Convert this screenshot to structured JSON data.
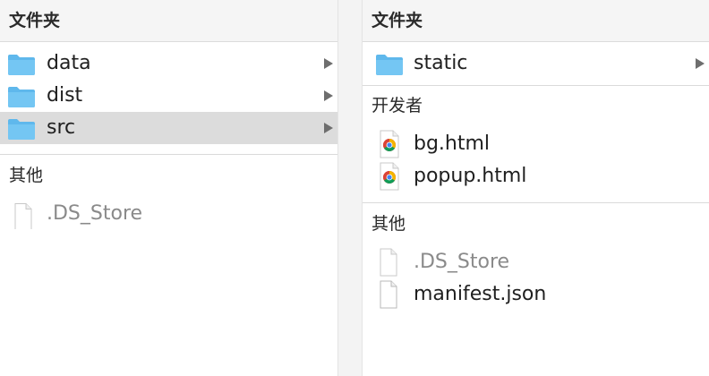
{
  "left_column": {
    "header": "文件夹",
    "folders": [
      {
        "name": "data",
        "selected": false
      },
      {
        "name": "dist",
        "selected": false
      },
      {
        "name": "src",
        "selected": true
      }
    ],
    "other_label": "其他",
    "other_files": [
      {
        "name": ".DS_Store",
        "muted": true,
        "icon": "blank-file-icon"
      }
    ]
  },
  "right_column": {
    "header": "文件夹",
    "folders": [
      {
        "name": "static",
        "selected": false
      }
    ],
    "developer_label": "开发者",
    "developer_files": [
      {
        "name": "bg.html",
        "icon": "chrome-html-file-icon"
      },
      {
        "name": "popup.html",
        "icon": "chrome-html-file-icon"
      }
    ],
    "other_label": "其他",
    "other_files": [
      {
        "name": ".DS_Store",
        "muted": true,
        "icon": "blank-file-icon"
      },
      {
        "name": "manifest.json",
        "muted": false,
        "icon": "blank-file-icon"
      }
    ]
  },
  "colors": {
    "folder": "#5fb8ec",
    "selection": "#dcdcdc",
    "muted_text": "#8a8a8a"
  }
}
